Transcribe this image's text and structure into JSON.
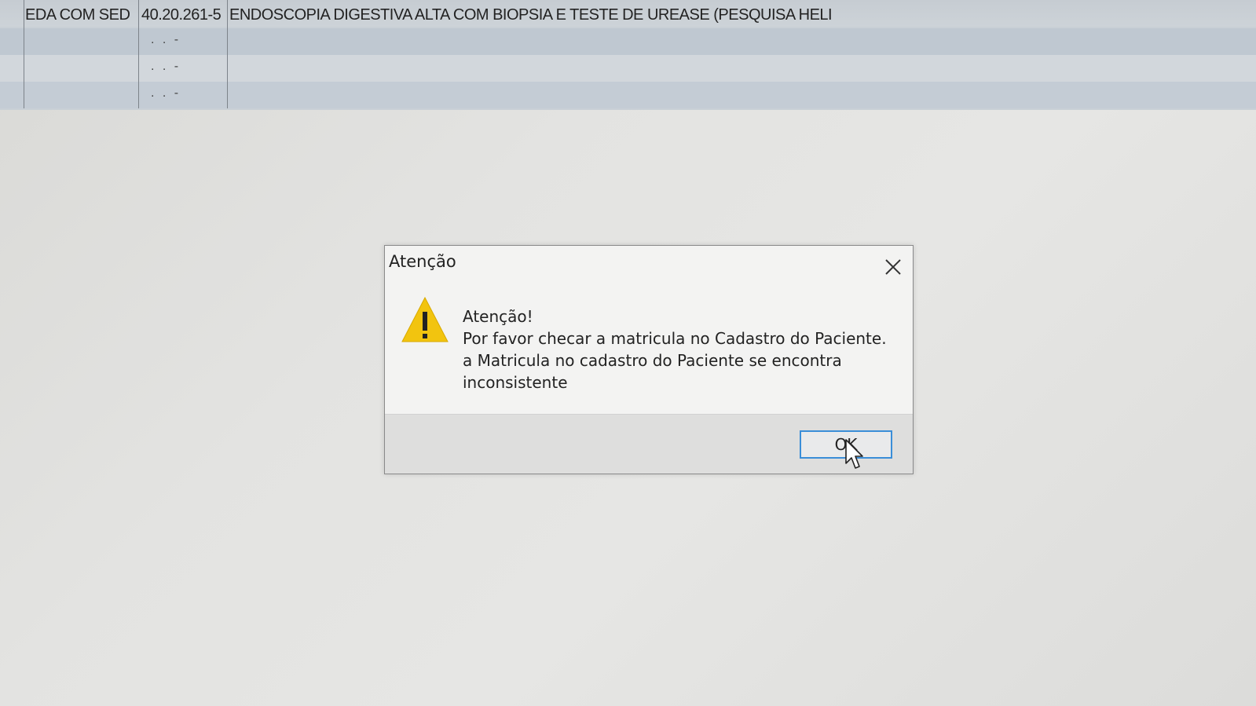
{
  "grid": {
    "row1": {
      "abbr": "EDA COM SED",
      "code": "40.20.261-5",
      "description": "ENDOSCOPIA DIGESTIVA ALTA COM BIOPSIA E TESTE DE UREASE (PESQUISA HELI"
    },
    "empty_code_placeholder": ". .  -"
  },
  "dialog": {
    "title": "Atenção",
    "close_icon": "close-icon",
    "warning_icon": "warning-icon",
    "message": {
      "line1": "Atenção!",
      "line2": "Por favor checar a matricula no Cadastro do Paciente.",
      "line3": "a Matricula no cadastro do Paciente se  encontra",
      "line4": "inconsistente"
    },
    "ok_label": "OK"
  },
  "colors": {
    "warning_yellow": "#f2c40f",
    "focus_blue": "#3a8ed8"
  }
}
